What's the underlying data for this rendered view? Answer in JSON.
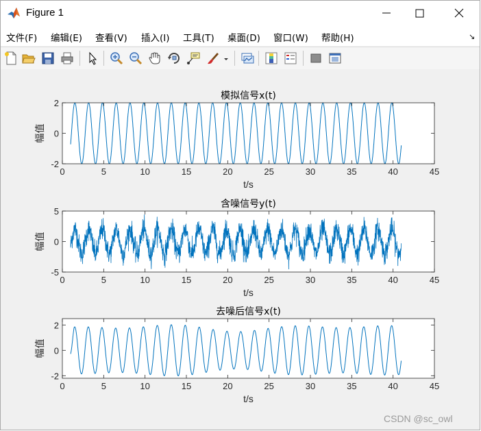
{
  "window": {
    "title": "Figure 1",
    "controls": [
      "minimize",
      "maximize",
      "close"
    ]
  },
  "menu": {
    "items": [
      "文件(F)",
      "编辑(E)",
      "查看(V)",
      "插入(I)",
      "工具(T)",
      "桌面(D)",
      "窗口(W)",
      "帮助(H)"
    ],
    "dock_arrow": "↘"
  },
  "toolbar": {
    "icons": [
      "new-figure-icon",
      "open-file-icon",
      "save-icon",
      "print-icon",
      "pointer-icon",
      "zoom-in-icon",
      "zoom-out-icon",
      "pan-hand-icon",
      "rotate-3d-icon",
      "data-cursor-icon",
      "brush-icon",
      "brush-dropdown-icon",
      "link-plot-icon",
      "colorbar-icon",
      "legend-icon",
      "hide-plot-tools-icon",
      "show-plot-tools-icon"
    ]
  },
  "colors": {
    "line": "#0072BD",
    "axes_background": "#ffffff",
    "figure_background": "#f0f0f0"
  },
  "chart_data": [
    {
      "type": "line",
      "title": "模拟信号x(t)",
      "xlabel": "t/s",
      "ylabel": "幅值",
      "xlim": [
        0,
        45
      ],
      "ylim": [
        -2,
        2
      ],
      "xticks": [
        0,
        5,
        10,
        15,
        20,
        25,
        30,
        35,
        40,
        45
      ],
      "yticks": [
        -2,
        0,
        2
      ],
      "signal": {
        "kind": "sine",
        "t_start": 1,
        "t_end": 41,
        "amplitude": 2,
        "frequency_hz": 0.6
      }
    },
    {
      "type": "line",
      "title": "含噪信号y(t)",
      "xlabel": "t/s",
      "ylabel": "幅值",
      "xlim": [
        0,
        45
      ],
      "ylim": [
        -5,
        5
      ],
      "xticks": [
        0,
        5,
        10,
        15,
        20,
        25,
        30,
        35,
        40,
        45
      ],
      "yticks": [
        -5,
        0,
        5
      ],
      "signal": {
        "kind": "sine_plus_noise",
        "t_start": 1,
        "t_end": 41,
        "amplitude": 2,
        "frequency_hz": 0.6,
        "noise_std": 0.9
      }
    },
    {
      "type": "line",
      "title": "去噪后信号x(t)",
      "xlabel": "t/s",
      "ylabel": "幅值",
      "xlim": [
        0,
        45
      ],
      "ylim": [
        -2.2,
        2.5
      ],
      "xticks": [
        0,
        5,
        10,
        15,
        20,
        25,
        30,
        35,
        40,
        45
      ],
      "yticks": [
        -2,
        0,
        2
      ],
      "signal": {
        "kind": "sine_filtered",
        "t_start": 1,
        "t_end": 41,
        "amplitude": 2.1,
        "frequency_hz": 0.6
      }
    }
  ],
  "watermark": "CSDN @sc_owl"
}
